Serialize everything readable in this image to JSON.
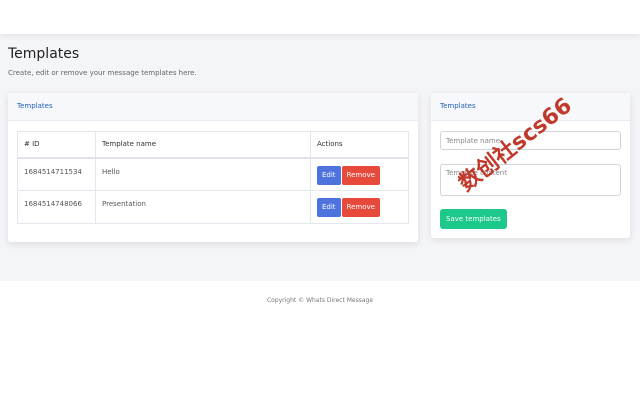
{
  "page": {
    "title": "Templates",
    "subtitle": "Create, edit or remove your message templates here."
  },
  "list_card": {
    "header": "Templates",
    "columns": [
      "# ID",
      "Template name",
      "Actions"
    ],
    "rows": [
      {
        "id": "1684514711534",
        "name": "Hello",
        "edit_label": "Edit",
        "remove_label": "Remove"
      },
      {
        "id": "1684514748066",
        "name": "Presentation",
        "edit_label": "Edit",
        "remove_label": "Remove"
      }
    ]
  },
  "form_card": {
    "header": "Templates",
    "name_placeholder": "Template name",
    "content_placeholder": "Template content",
    "save_label": "Save templates"
  },
  "footer": {
    "copyright": "Copyright © Whats Direct Message"
  },
  "watermark": {
    "text": "数创社scs66",
    "color": "#c0392b"
  },
  "colors": {
    "edit": "#4e73df",
    "remove": "#e74a3b",
    "save": "#1cc88a",
    "card_header_text": "#1f5fbf"
  }
}
